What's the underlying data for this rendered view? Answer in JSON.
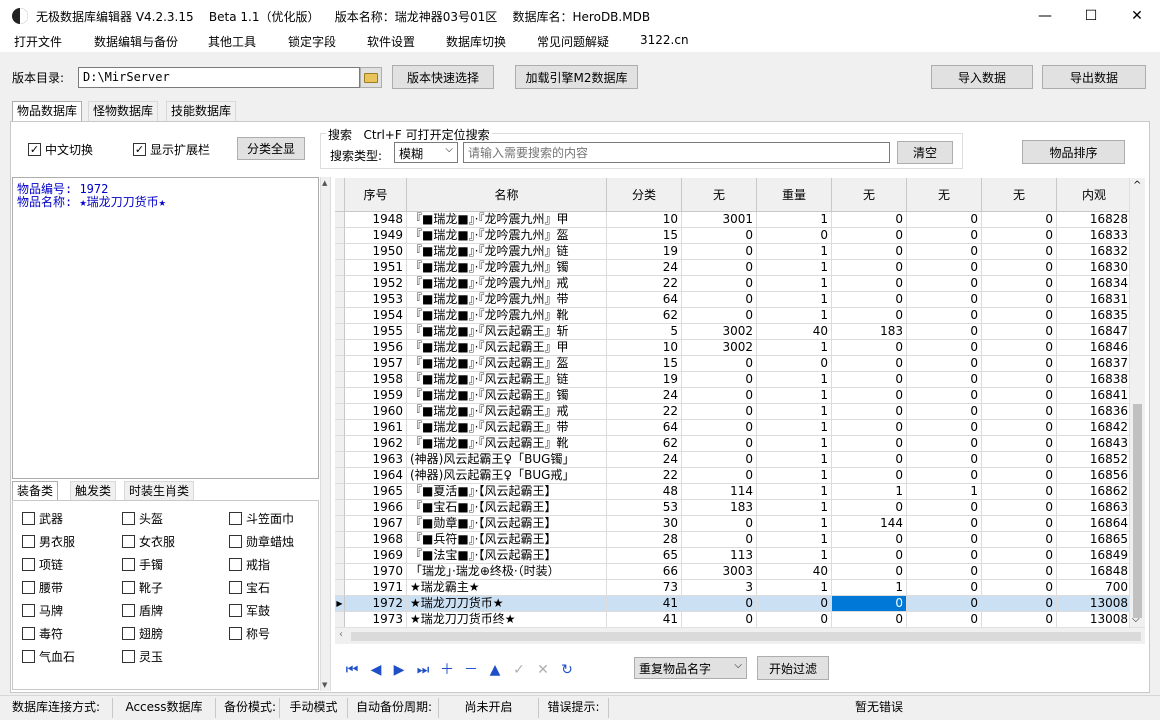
{
  "window": {
    "title": "无极数据库编辑器 V4.2.3.15    Beta 1.1（优化版）    版本名称：瑞龙神器03号01区    数据库名：HeroDB.MDB",
    "min_icon": "—",
    "max_icon": "☐",
    "close_icon": "✕"
  },
  "menu": [
    "打开文件",
    "数据编辑与备份",
    "其他工具",
    "锁定字段",
    "软件设置",
    "数据库切换",
    "常见问题解疑",
    "3122.cn"
  ],
  "toolbar": {
    "version_dir_label": "版本目录:",
    "version_dir_value": "D:\\MirServer",
    "quick_select": "版本快速选择",
    "load_engine": "加载引擎M2数据库",
    "import": "导入数据",
    "export": "导出数据"
  },
  "tabs": [
    "物品数据库",
    "怪物数据库",
    "技能数据库"
  ],
  "options": {
    "chinese_switch": "中文切换",
    "show_ext": "显示扩展栏",
    "show_all_categories": "分类全显",
    "search_title": "搜索   Ctrl+F 可打开定位搜索",
    "search_type_label": "搜索类型:",
    "search_type_value": "模糊",
    "search_placeholder": "请输入需要搜索的内容",
    "clear": "清空",
    "sort": "物品排序"
  },
  "info": {
    "line1": "物品编号: 1972",
    "line2": "物品名称: ★瑞龙刀刀货币★"
  },
  "category_tabs": [
    "装备类",
    "触发类",
    "时装生肖类"
  ],
  "categories": [
    [
      "武器",
      "头盔",
      "斗笠面巾"
    ],
    [
      "男衣服",
      "女衣服",
      "勋章蜡烛"
    ],
    [
      "项链",
      "手镯",
      "戒指"
    ],
    [
      "腰带",
      "靴子",
      "宝石"
    ],
    [
      "马牌",
      "盾牌",
      "军鼓"
    ],
    [
      "毒符",
      "翅膀",
      "称号"
    ],
    [
      "气血石",
      "灵玉"
    ]
  ],
  "grid": {
    "headers": [
      "序号",
      "名称",
      "分类",
      "无",
      "重量",
      "无",
      "无",
      "无",
      "内观"
    ],
    "rows": [
      [
        "1948",
        "『■瑞龙■』·『龙吟震九州』甲",
        "10",
        "3001",
        "1",
        "0",
        "0",
        "0",
        "16828"
      ],
      [
        "1949",
        "『■瑞龙■』·『龙吟震九州』盔",
        "15",
        "0",
        "0",
        "0",
        "0",
        "0",
        "16833"
      ],
      [
        "1950",
        "『■瑞龙■』·『龙吟震九州』链",
        "19",
        "0",
        "1",
        "0",
        "0",
        "0",
        "16832"
      ],
      [
        "1951",
        "『■瑞龙■』·『龙吟震九州』镯",
        "24",
        "0",
        "1",
        "0",
        "0",
        "0",
        "16830"
      ],
      [
        "1952",
        "『■瑞龙■』·『龙吟震九州』戒",
        "22",
        "0",
        "1",
        "0",
        "0",
        "0",
        "16834"
      ],
      [
        "1953",
        "『■瑞龙■』·『龙吟震九州』带",
        "64",
        "0",
        "1",
        "0",
        "0",
        "0",
        "16831"
      ],
      [
        "1954",
        "『■瑞龙■』·『龙吟震九州』靴",
        "62",
        "0",
        "1",
        "0",
        "0",
        "0",
        "16835"
      ],
      [
        "1955",
        "『■瑞龙■』·『风云起霸王』斩",
        "5",
        "3002",
        "40",
        "183",
        "0",
        "0",
        "16847"
      ],
      [
        "1956",
        "『■瑞龙■』·『风云起霸王』甲",
        "10",
        "3002",
        "1",
        "0",
        "0",
        "0",
        "16846"
      ],
      [
        "1957",
        "『■瑞龙■』·『风云起霸王』盔",
        "15",
        "0",
        "0",
        "0",
        "0",
        "0",
        "16837"
      ],
      [
        "1958",
        "『■瑞龙■』·『风云起霸王』链",
        "19",
        "0",
        "1",
        "0",
        "0",
        "0",
        "16838"
      ],
      [
        "1959",
        "『■瑞龙■』·『风云起霸王』镯",
        "24",
        "0",
        "1",
        "0",
        "0",
        "0",
        "16841"
      ],
      [
        "1960",
        "『■瑞龙■』·『风云起霸王』戒",
        "22",
        "0",
        "1",
        "0",
        "0",
        "0",
        "16836"
      ],
      [
        "1961",
        "『■瑞龙■』·『风云起霸王』带",
        "64",
        "0",
        "1",
        "0",
        "0",
        "0",
        "16842"
      ],
      [
        "1962",
        "『■瑞龙■』·『风云起霸王』靴",
        "62",
        "0",
        "1",
        "0",
        "0",
        "0",
        "16843"
      ],
      [
        "1963",
        "(神器)风云起霸王♀「BUG镯」",
        "24",
        "0",
        "1",
        "0",
        "0",
        "0",
        "16852"
      ],
      [
        "1964",
        "(神器)风云起霸王♀「BUG戒」",
        "22",
        "0",
        "1",
        "0",
        "0",
        "0",
        "16856"
      ],
      [
        "1965",
        "『■夏活■』·【风云起霸王】",
        "48",
        "114",
        "1",
        "1",
        "1",
        "0",
        "16862"
      ],
      [
        "1966",
        "『■宝石■』·【风云起霸王】",
        "53",
        "183",
        "1",
        "0",
        "0",
        "0",
        "16863"
      ],
      [
        "1967",
        "『■勋章■』·【风云起霸王】",
        "30",
        "0",
        "1",
        "144",
        "0",
        "0",
        "16864"
      ],
      [
        "1968",
        "『■兵符■』·【风云起霸王】",
        "28",
        "0",
        "1",
        "0",
        "0",
        "0",
        "16865"
      ],
      [
        "1969",
        "『■法宝■』·【风云起霸王】",
        "65",
        "113",
        "1",
        "0",
        "0",
        "0",
        "16849"
      ],
      [
        "1970",
        "「瑞龙」·瑞龙⊕终极·（时装）",
        "66",
        "3003",
        "40",
        "0",
        "0",
        "0",
        "16848"
      ],
      [
        "1971",
        "★瑞龙霸主★",
        "73",
        "3",
        "1",
        "1",
        "0",
        "0",
        "700"
      ],
      [
        "1972",
        "★瑞龙刀刀货币★",
        "41",
        "0",
        "0",
        "0",
        "0",
        "0",
        "13008"
      ],
      [
        "1973",
        "★瑞龙刀刀货币终★",
        "41",
        "0",
        "0",
        "0",
        "0",
        "0",
        "13008"
      ]
    ],
    "selected_index": 24
  },
  "bottom": {
    "filter_select": "重复物品名字",
    "start_filter": "开始过滤"
  },
  "status": {
    "conn_label": "数据库连接方式:",
    "conn_value": "Access数据库",
    "backup_label": "备份模式:",
    "backup_value": "手动模式",
    "auto_label": "自动备份周期:",
    "auto_value": "尚未开启",
    "err_label": "错误提示:",
    "err_value": "暂无错误"
  }
}
